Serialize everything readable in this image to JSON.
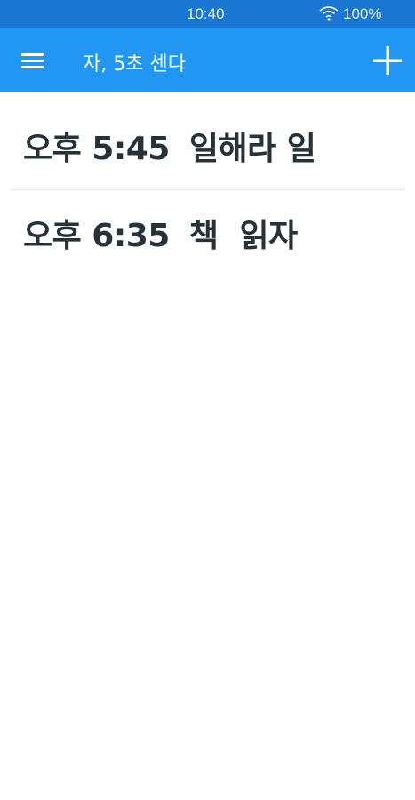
{
  "status_bar": {
    "time": "10:40",
    "battery": "100%",
    "wifi_icon": "wifi-icon"
  },
  "app_bar": {
    "menu_icon": "menu-icon",
    "title": "자, 5초 센다",
    "add_icon": "add-icon"
  },
  "colors": {
    "status_bar": "#1976D2",
    "app_bar": "#2196F3",
    "item_text": "#263238"
  },
  "items": [
    {
      "time": "오후 5:45",
      "title": "일해라 일"
    },
    {
      "time": "오후 6:35",
      "title": "책  읽자"
    }
  ]
}
